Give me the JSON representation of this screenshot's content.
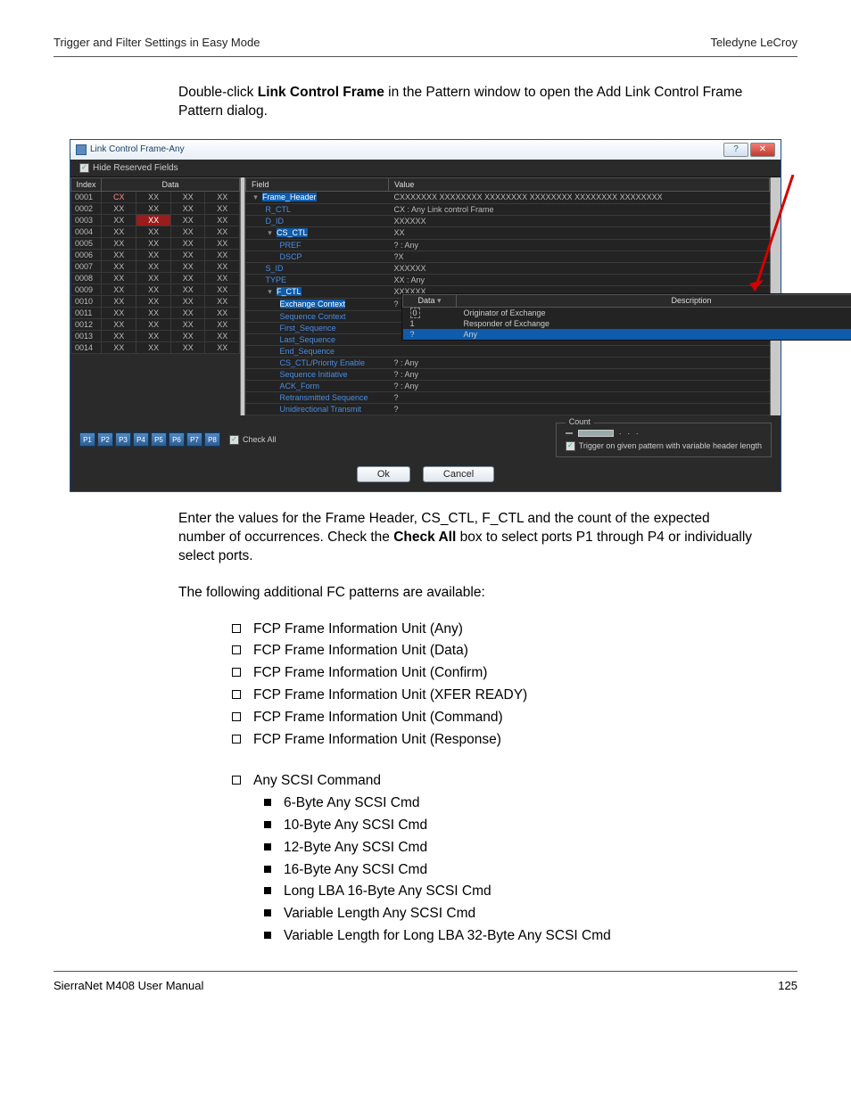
{
  "header": {
    "left": "Trigger and Filter Settings in Easy Mode",
    "right": "Teledyne LeCroy"
  },
  "intro1a": "Double-click ",
  "intro1b": "Link Control Frame",
  "intro1c": " in the Pattern window to open the Add Link Control Frame Pattern dialog.",
  "dialog": {
    "title": "Link Control Frame-Any",
    "hide_label": "Hide Reserved Fields",
    "left_header_index": "Index",
    "left_header_data": "Data",
    "rows": [
      {
        "idx": "0001",
        "c": [
          "CX",
          "XX",
          "XX",
          "XX"
        ],
        "red": [
          0
        ]
      },
      {
        "idx": "0002",
        "c": [
          "XX",
          "XX",
          "XX",
          "XX"
        ]
      },
      {
        "idx": "0003",
        "c": [
          "XX",
          "XX",
          "XX",
          "XX"
        ],
        "hot": [
          1
        ]
      },
      {
        "idx": "0004",
        "c": [
          "XX",
          "XX",
          "XX",
          "XX"
        ]
      },
      {
        "idx": "0005",
        "c": [
          "XX",
          "XX",
          "XX",
          "XX"
        ]
      },
      {
        "idx": "0006",
        "c": [
          "XX",
          "XX",
          "XX",
          "XX"
        ]
      },
      {
        "idx": "0007",
        "c": [
          "XX",
          "XX",
          "XX",
          "XX"
        ]
      },
      {
        "idx": "0008",
        "c": [
          "XX",
          "XX",
          "XX",
          "XX"
        ]
      },
      {
        "idx": "0009",
        "c": [
          "XX",
          "XX",
          "XX",
          "XX"
        ]
      },
      {
        "idx": "0010",
        "c": [
          "XX",
          "XX",
          "XX",
          "XX"
        ]
      },
      {
        "idx": "0011",
        "c": [
          "XX",
          "XX",
          "XX",
          "XX"
        ]
      },
      {
        "idx": "0012",
        "c": [
          "XX",
          "XX",
          "XX",
          "XX"
        ]
      },
      {
        "idx": "0013",
        "c": [
          "XX",
          "XX",
          "XX",
          "XX"
        ]
      },
      {
        "idx": "0014",
        "c": [
          "XX",
          "XX",
          "XX",
          "XX"
        ]
      }
    ],
    "right_header_field": "Field",
    "right_header_value": "Value",
    "fields": [
      {
        "ind": 0,
        "exp": "▾",
        "name": "Frame_Header",
        "val": "CXXXXXXX XXXXXXXX XXXXXXXX XXXXXXXX XXXXXXXX XXXXXXXX",
        "hl": true
      },
      {
        "ind": 1,
        "name": "R_CTL",
        "val": "CX : Any Link control Frame"
      },
      {
        "ind": 1,
        "name": "D_ID",
        "val": "XXXXXX"
      },
      {
        "ind": 1,
        "exp": "▾",
        "name": "CS_CTL",
        "val": "XX",
        "hl": true,
        "valhl": true
      },
      {
        "ind": 2,
        "name": "PREF",
        "val": "? : Any"
      },
      {
        "ind": 2,
        "name": "DSCP",
        "val": "?X"
      },
      {
        "ind": 1,
        "name": "S_ID",
        "val": "XXXXXX"
      },
      {
        "ind": 1,
        "name": "TYPE",
        "val": "XX : Any"
      },
      {
        "ind": 1,
        "exp": "▾",
        "name": "F_CTL",
        "val": "XXXXXX",
        "hl": true
      },
      {
        "ind": 2,
        "name": "Exchange Context",
        "val": "?",
        "hl": true,
        "valhl2": true
      },
      {
        "ind": 2,
        "name": "Sequence Context",
        "val": ""
      },
      {
        "ind": 2,
        "name": "First_Sequence",
        "val": ""
      },
      {
        "ind": 2,
        "name": "Last_Sequence",
        "val": ""
      },
      {
        "ind": 2,
        "name": "End_Sequence",
        "val": ""
      },
      {
        "ind": 2,
        "name": "CS_CTL/Priority Enable",
        "val": "? : Any"
      },
      {
        "ind": 2,
        "name": "Sequence Initiative",
        "val": "? : Any"
      },
      {
        "ind": 2,
        "name": "ACK_Form",
        "val": "? : Any"
      },
      {
        "ind": 2,
        "name": "Retransmitted Sequence",
        "val": "?"
      },
      {
        "ind": 2,
        "name": "Unidirectional Transmit",
        "val": "?"
      }
    ],
    "dropdown": {
      "h_data": "Data",
      "h_desc": "Description",
      "rows": [
        {
          "d": "0",
          "desc": "Originator of Exchange",
          "edit": true
        },
        {
          "d": "1",
          "desc": "Responder of Exchange"
        },
        {
          "d": "?",
          "desc": "Any",
          "sel": true
        }
      ]
    },
    "ports": [
      "P1",
      "P2",
      "P3",
      "P4",
      "P5",
      "P6",
      "P7",
      "P8"
    ],
    "check_all": "Check All",
    "count_label": "Count",
    "trigger_label": "Trigger on given pattern with variable header length",
    "ok": "Ok",
    "cancel": "Cancel"
  },
  "after1a": "Enter the values for the Frame Header, CS_CTL, F_CTL and the count of the expected number of occurrences. Check the ",
  "after1b": "Check All",
  "after1c": " box to select ports P1 through P4 or individually select ports.",
  "after2": "The following additional FC patterns are available:",
  "list1": [
    "FCP Frame Information Unit (Any)",
    "FCP Frame Information Unit (Data)",
    "FCP Frame Information Unit (Confirm)",
    "FCP Frame Information Unit (XFER READY)",
    "FCP Frame Information Unit (Command)",
    "FCP Frame Information Unit (Response)"
  ],
  "list2_head": "Any SCSI Command",
  "list2_sub": [
    "6-Byte Any SCSI Cmd",
    "10-Byte Any SCSI Cmd",
    "12-Byte Any SCSI Cmd",
    "16-Byte Any SCSI Cmd",
    "Long LBA 16-Byte Any SCSI Cmd",
    "Variable Length Any SCSI Cmd",
    "Variable Length for Long LBA 32-Byte Any SCSI Cmd"
  ],
  "footer": {
    "left": "SierraNet M408 User Manual",
    "right": "125"
  }
}
